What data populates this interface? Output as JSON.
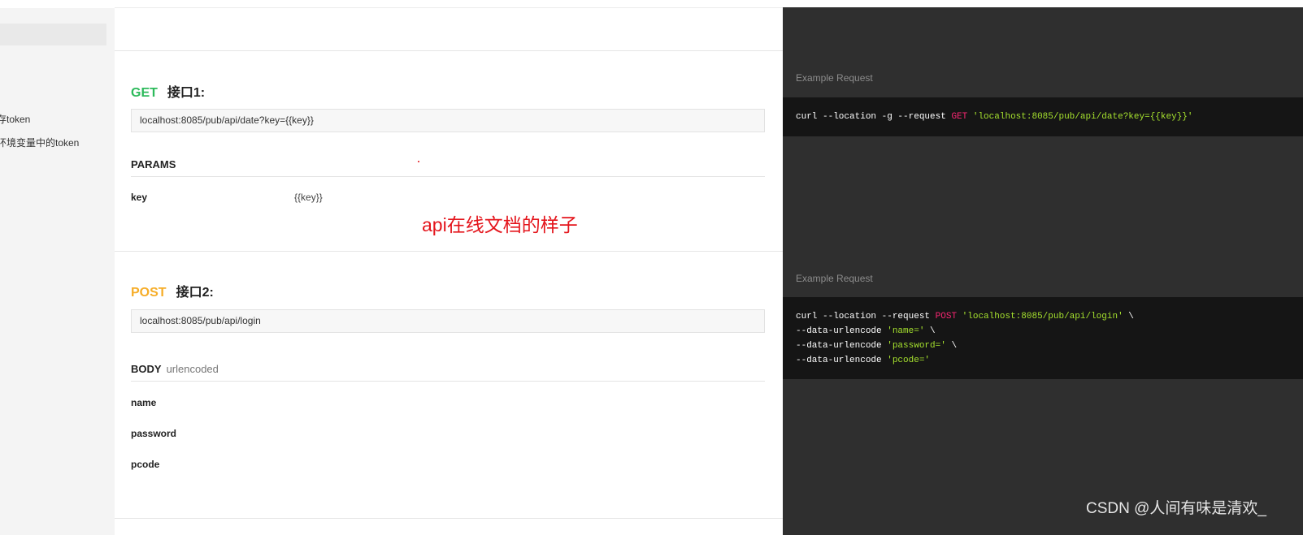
{
  "sidebar": {
    "items": [
      {
        "label": "存token"
      },
      {
        "label": "环境变量中的token"
      }
    ]
  },
  "endpoints": [
    {
      "method": "GET",
      "title": "接口1:",
      "url": "localhost:8085/pub/api/date?key={{key}}",
      "section_label": "PARAMS",
      "section_note": "",
      "params": [
        {
          "key": "key",
          "value": "{{key}}"
        }
      ]
    },
    {
      "method": "POST",
      "title": "接口2:",
      "url": "localhost:8085/pub/api/login",
      "section_label": "BODY",
      "section_note": "urlencoded",
      "params": [
        {
          "key": "name",
          "value": ""
        },
        {
          "key": "password",
          "value": ""
        },
        {
          "key": "pcode",
          "value": ""
        }
      ]
    }
  ],
  "annotation": "api在线文档的样子",
  "examples": [
    {
      "label": "Example Request",
      "lines": [
        {
          "pre": "curl --location -g --request ",
          "method": "GET",
          "mid": " ",
          "str": "'localhost:8085/pub/api/date?key={{key}}'",
          "post": ""
        }
      ]
    },
    {
      "label": "Example Request",
      "lines": [
        {
          "pre": "curl --location --request ",
          "method": "POST",
          "mid": " ",
          "str": "'localhost:8085/pub/api/login'",
          "post": " \\"
        },
        {
          "pre": "--data-urlencode ",
          "method": "",
          "mid": "",
          "str": "'name='",
          "post": " \\"
        },
        {
          "pre": "--data-urlencode ",
          "method": "",
          "mid": "",
          "str": "'password='",
          "post": " \\"
        },
        {
          "pre": "--data-urlencode ",
          "method": "",
          "mid": "",
          "str": "'pcode='",
          "post": ""
        }
      ]
    }
  ],
  "watermark": "CSDN @人间有味是清欢_",
  "colors": {
    "get": "#2dba5b",
    "post": "#f6ad28",
    "annotation": "#e4141b",
    "code_bg": "#151515",
    "panel_bg": "#2f2f2f"
  }
}
